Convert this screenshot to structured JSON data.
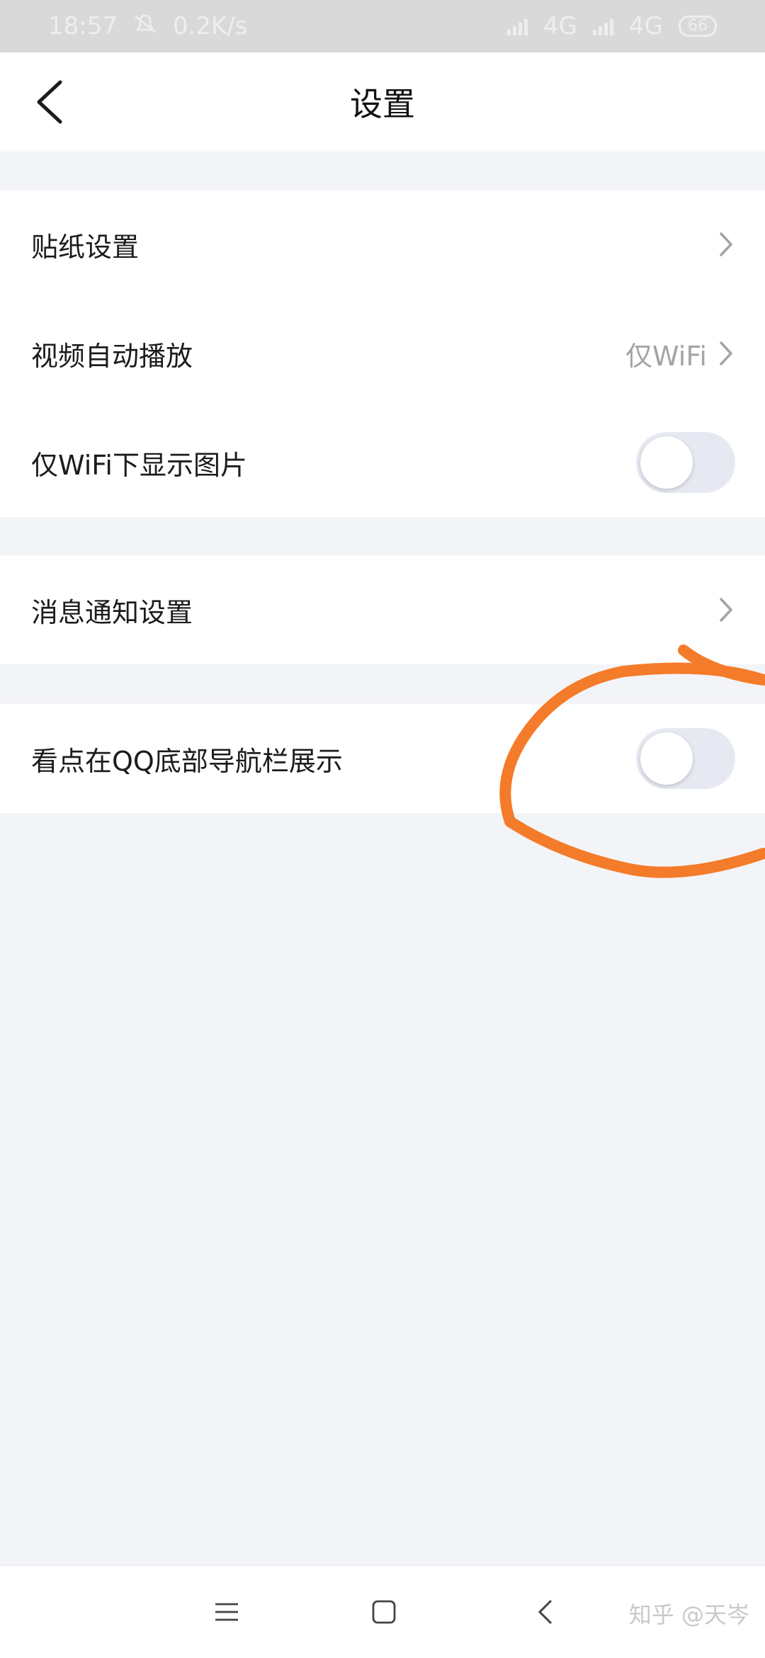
{
  "status_bar": {
    "time": "18:57",
    "net_speed": "0.2K/s",
    "network_1": "4G",
    "network_2": "4G",
    "battery": "66"
  },
  "header": {
    "title": "设置",
    "back_icon": "chevron-left-icon"
  },
  "group1": {
    "items": [
      {
        "label": "贴纸设置",
        "type": "link"
      },
      {
        "label": "视频自动播放",
        "value": "仅WiFi",
        "type": "link"
      },
      {
        "label": "仅WiFi下显示图片",
        "type": "toggle",
        "on": false
      }
    ]
  },
  "group2": {
    "items": [
      {
        "label": "消息通知设置",
        "type": "link"
      }
    ]
  },
  "group3": {
    "items": [
      {
        "label": "看点在QQ底部导航栏展示",
        "type": "toggle",
        "on": false
      }
    ]
  },
  "annotation": {
    "color": "#f47b2a"
  },
  "bottom_nav": {
    "menu_icon": "menu-icon",
    "home_icon": "square-home-icon",
    "back_icon": "triangle-back-icon",
    "watermark": "知乎 @天岑"
  },
  "colors": {
    "background": "#f3f4f8",
    "surface": "#ffffff",
    "secondary_text": "#a3a3a8",
    "toggle_off": "#e6e9f1"
  }
}
